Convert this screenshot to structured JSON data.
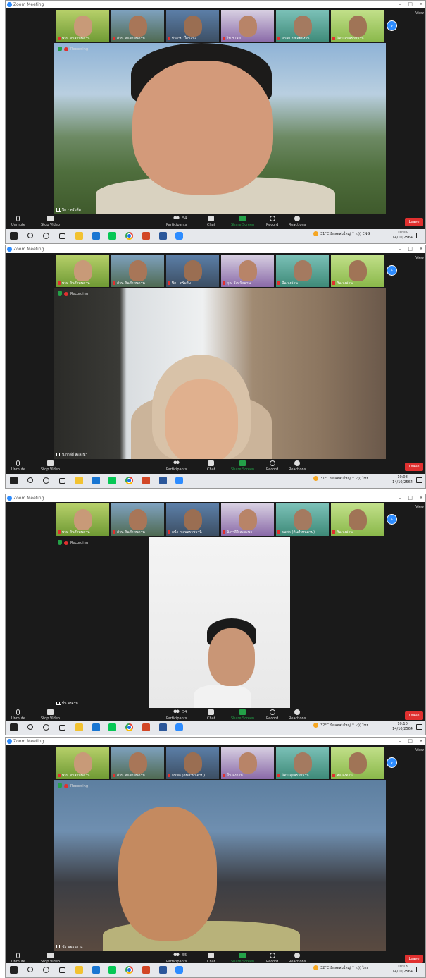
{
  "window_title": "Zoom Meeting",
  "view_label": "View",
  "recording_label": "Recording",
  "controls": {
    "unmute": "Unmute",
    "stop_video": "Stop Video",
    "participants": "Participants",
    "chat": "Chat",
    "share_screen": "Share Screen",
    "record": "Record",
    "reactions": "Reactions",
    "leave": "Leave"
  },
  "screens": [
    {
      "thumbnails": [
        "พรม ดินสำหนดาน",
        "ด้าน ดินสำหนดาน",
        "ป้าอาม ปั๊ดนะน่ะ",
        "ไป ฯ เลข",
        "มาลย ฯ ขอยนงาน",
        "น้อม อุบลราชธานี"
      ],
      "speaker": "ปิด - ครับส้ม",
      "participants_count": "54",
      "weather": "31°C มีผลตสมใหญ่",
      "lang": "ENG",
      "time": "10:05",
      "date": "14/10/2564"
    },
    {
      "thumbnails": [
        "พรม ดินสำหนดาน",
        "ด้าน ดินสำหนดาน",
        "ปิด - ครับส้ม",
        "คุณ จังหวัดนาน",
        "ปั้น จงอ่าน",
        "ศิน จงอ่าน"
      ],
      "speaker": "นิ กาลีย์ สะละนา",
      "participants_count": "",
      "weather": "31°C มีผลตสมใหญ่",
      "lang": "ไทย",
      "time": "10:08",
      "date": "14/10/2564"
    },
    {
      "thumbnails": [
        "พรม ดินสำหนดาน",
        "ด้าน ดินสำหนดาน",
        "กน้ำ ฯ อุบลราชธานี",
        "นิ กาลีย์ สะละนา",
        "ธนพล (ดินสำหนดาน)",
        "ศิน จงอ่าน"
      ],
      "speaker": "ปั้น จงอ่าน",
      "participants_count": "54",
      "weather": "32°C มีผลตสมใหญ่",
      "lang": "ไทย",
      "time": "10:10",
      "date": "14/10/2564"
    },
    {
      "thumbnails": [
        "พรม ดินสำหนดาน",
        "ด้าน ดินสำหนดาน",
        "ธนพล (ดินสำหนดาน)",
        "ปั้น จงอ่าน",
        "น้อม อุบลราชธานี",
        "ศิน จงอ่าน"
      ],
      "speaker": "ชัย ขอยนงาน",
      "participants_count": "55",
      "weather": "32°C มีผลตสมใหญ่",
      "lang": "ไทย",
      "time": "10:13",
      "date": "14/10/2564"
    }
  ]
}
